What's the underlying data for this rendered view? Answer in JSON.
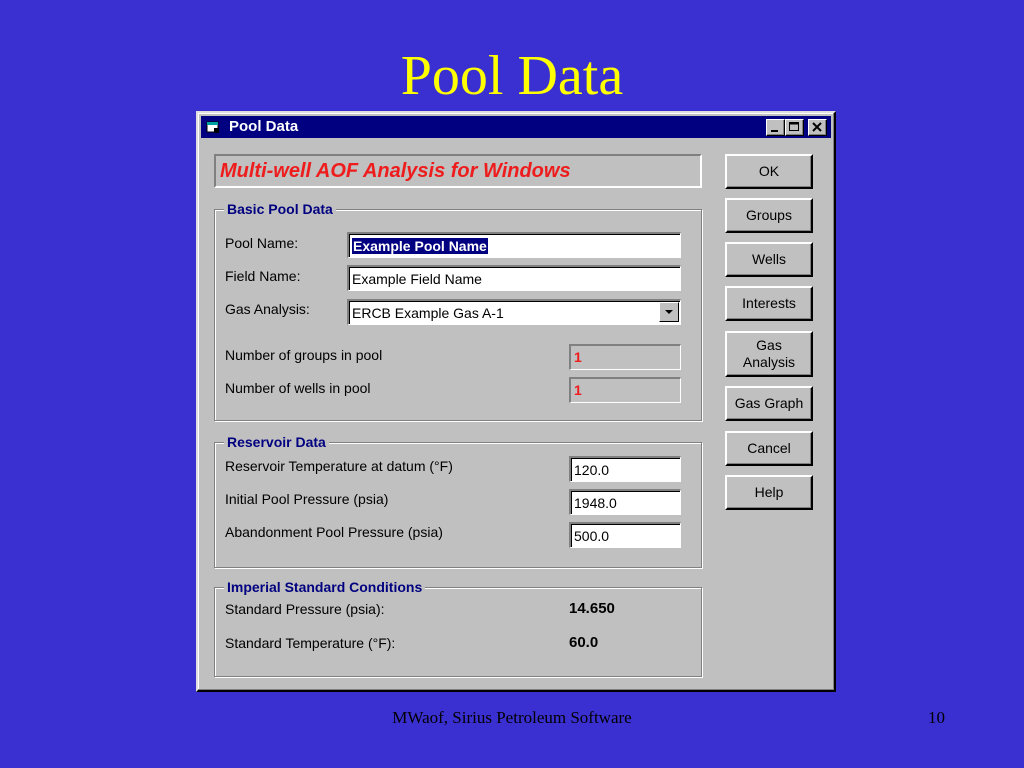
{
  "slide": {
    "title": "Pool Data",
    "footer": "MWaof, Sirius Petroleum Software",
    "page_number": "10"
  },
  "window": {
    "title": "Pool Data",
    "icon": "app-window-icon",
    "controls": [
      "minimize-icon",
      "maximize-icon",
      "close-icon"
    ]
  },
  "banner": {
    "text": "Multi-well AOF Analysis for Windows",
    "color": "#ee1c1c"
  },
  "basic_pool_data": {
    "legend": "Basic Pool Data",
    "pool_name_label": "Pool Name:",
    "pool_name_value": "Example Pool Name",
    "field_name_label": "Field Name:",
    "field_name_value": "Example Field Name",
    "gas_analysis_label": "Gas Analysis:",
    "gas_analysis_value": "ERCB Example Gas A-1",
    "groups_label": "Number of groups in pool",
    "groups_value": "1",
    "wells_label": "Number of wells in pool",
    "wells_value": "1"
  },
  "reservoir_data": {
    "legend": "Reservoir Data",
    "temperature_label": "Reservoir Temperature at datum (°F)",
    "temperature_value": "120.0",
    "initial_pressure_label": "Initial Pool Pressure (psia)",
    "initial_pressure_value": "1948.0",
    "abandonment_pressure_label": "Abandonment Pool Pressure (psia)",
    "abandonment_pressure_value": "500.0"
  },
  "imperial_conditions": {
    "legend": "Imperial Standard Conditions",
    "std_pressure_label": "Standard Pressure (psia):",
    "std_pressure_value": "14.650",
    "std_temperature_label": "Standard Temperature (°F):",
    "std_temperature_value": "60.0"
  },
  "buttons": {
    "ok": "OK",
    "groups": "Groups",
    "wells": "Wells",
    "interests": "Interests",
    "gas_analysis": "Gas\nAnalysis",
    "gas_graph": "Gas Graph",
    "cancel": "Cancel",
    "help": "Help"
  },
  "colors": {
    "slide_background": "#3a2fd0",
    "slide_title": "#ffff00",
    "titlebar": "#000080",
    "legend_text": "#000080"
  }
}
